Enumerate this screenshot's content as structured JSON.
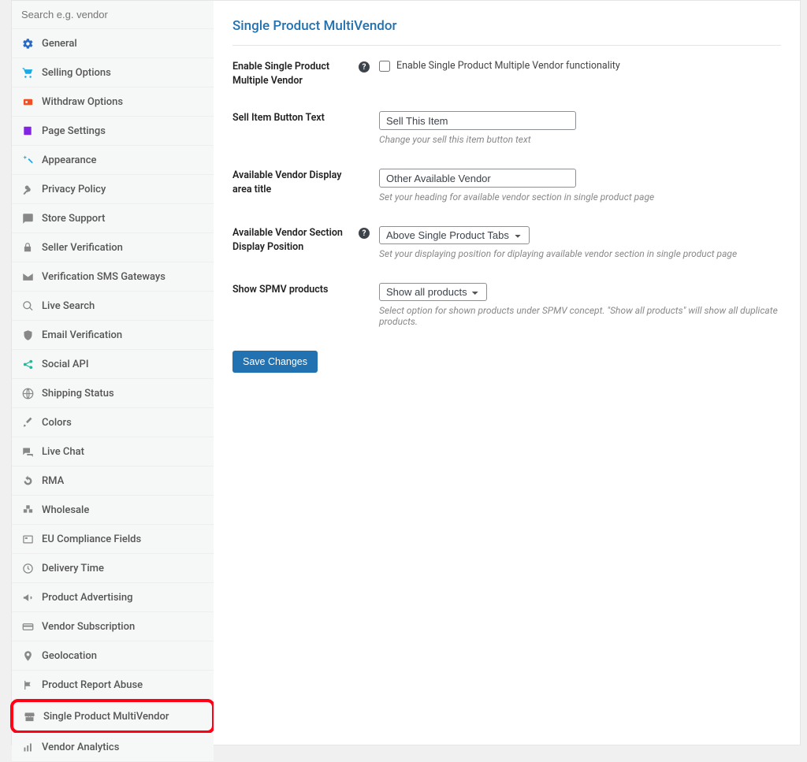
{
  "search": {
    "placeholder": "Search e.g. vendor"
  },
  "sidebar": {
    "items": [
      {
        "label": "General",
        "icon": "gear-icon",
        "color": "#2a6ac1"
      },
      {
        "label": "Selling Options",
        "icon": "cart-icon",
        "color": "#1aaae3"
      },
      {
        "label": "Withdraw Options",
        "icon": "withdraw-icon",
        "color": "#f05025"
      },
      {
        "label": "Page Settings",
        "icon": "page-icon",
        "color": "#8224e3"
      },
      {
        "label": "Appearance",
        "icon": "magic-icon",
        "color": "#1aaae3"
      },
      {
        "label": "Privacy Policy",
        "icon": "key-icon",
        "color": "#888"
      },
      {
        "label": "Store Support",
        "icon": "chat-icon",
        "color": "#888"
      },
      {
        "label": "Seller Verification",
        "icon": "lock-icon",
        "color": "#888"
      },
      {
        "label": "Verification SMS Gateways",
        "icon": "mail-icon",
        "color": "#888"
      },
      {
        "label": "Live Search",
        "icon": "search-icon",
        "color": "#888"
      },
      {
        "label": "Email Verification",
        "icon": "shield-icon",
        "color": "#888"
      },
      {
        "label": "Social API",
        "icon": "share-icon",
        "color": "#1abc9c"
      },
      {
        "label": "Shipping Status",
        "icon": "globe-icon",
        "color": "#888"
      },
      {
        "label": "Colors",
        "icon": "brush-icon",
        "color": "#888"
      },
      {
        "label": "Live Chat",
        "icon": "livechat-icon",
        "color": "#888"
      },
      {
        "label": "RMA",
        "icon": "undo-icon",
        "color": "#888"
      },
      {
        "label": "Wholesale",
        "icon": "wholesale-icon",
        "color": "#888"
      },
      {
        "label": "EU Compliance Fields",
        "icon": "map-icon",
        "color": "#888"
      },
      {
        "label": "Delivery Time",
        "icon": "clock-icon",
        "color": "#888"
      },
      {
        "label": "Product Advertising",
        "icon": "bullhorn-icon",
        "color": "#888"
      },
      {
        "label": "Vendor Subscription",
        "icon": "card-icon",
        "color": "#888"
      },
      {
        "label": "Geolocation",
        "icon": "pin-icon",
        "color": "#888"
      },
      {
        "label": "Product Report Abuse",
        "icon": "flag-icon",
        "color": "#888"
      },
      {
        "label": "Single Product MultiVendor",
        "icon": "store-icon",
        "color": "#888",
        "active": true
      },
      {
        "label": "Vendor Analytics",
        "icon": "chart-icon",
        "color": "#888"
      }
    ]
  },
  "content": {
    "title": "Single Product MultiVendor",
    "enable": {
      "label": "Enable Single Product Multiple Vendor",
      "checkbox_label": "Enable Single Product Multiple Vendor functionality"
    },
    "sell_button": {
      "label": "Sell Item Button Text",
      "value": "Sell This Item",
      "desc": "Change your sell this item button text"
    },
    "display_title": {
      "label": "Available Vendor Display area title",
      "value": "Other Available Vendor",
      "desc": "Set your heading for available vendor section in single product page"
    },
    "display_position": {
      "label": "Available Vendor Section Display Position",
      "value": "Above Single Product Tabs",
      "desc": "Set your displaying position for diplaying available vendor section in single product page"
    },
    "show_spmv": {
      "label": "Show SPMV products",
      "value": "Show all products",
      "desc": "Select option for shown products under SPMV concept. \"Show all products\" will show all duplicate products."
    },
    "save_button": "Save Changes"
  }
}
